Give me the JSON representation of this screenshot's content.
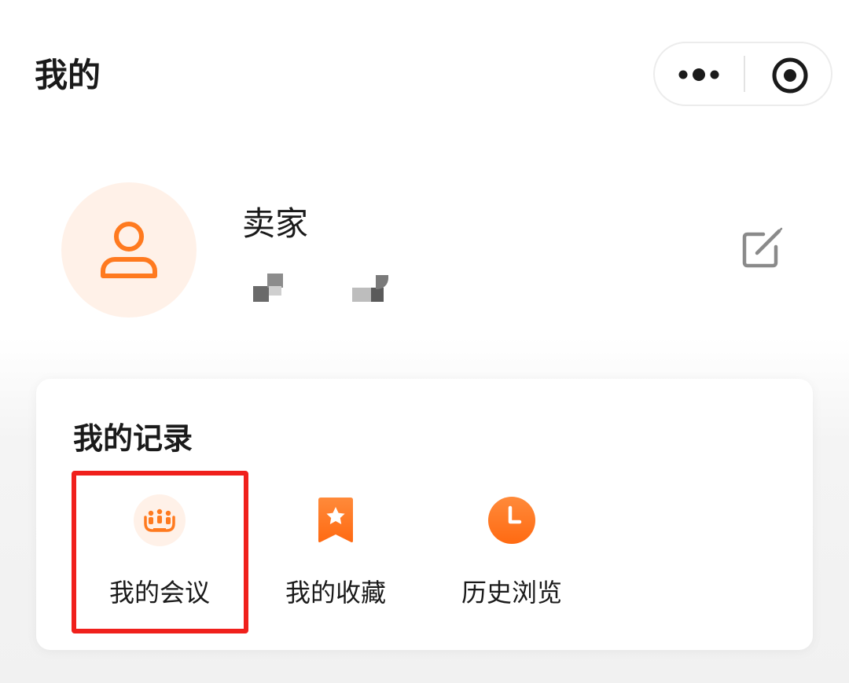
{
  "header": {
    "title": "我的",
    "menu_capsule": {
      "more_icon": "more-dots-icon",
      "close_icon": "target-close-icon"
    }
  },
  "profile": {
    "avatar_icon": "user-icon",
    "name": "卖家",
    "edit_icon": "edit-icon"
  },
  "records": {
    "title": "我的记录",
    "items": [
      {
        "label": "我的会议",
        "icon": "meeting-people-icon"
      },
      {
        "label": "我的收藏",
        "icon": "bookmark-star-icon"
      },
      {
        "label": "历史浏览",
        "icon": "clock-icon"
      }
    ]
  },
  "colors": {
    "accent_orange": "#ff7a1f",
    "avatar_bg": "#fff1e8",
    "highlight_red": "#f0201c"
  }
}
